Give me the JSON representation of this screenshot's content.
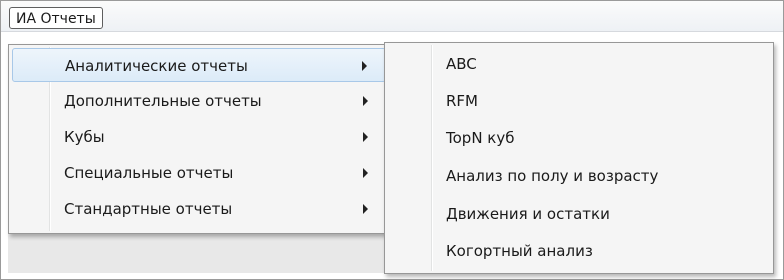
{
  "menubar": {
    "title": "ИА Отчеты"
  },
  "main_menu": {
    "items": [
      {
        "label": "Аналитические отчеты",
        "has_submenu": true,
        "highlighted": true
      },
      {
        "label": "Дополнительные отчеты",
        "has_submenu": true,
        "highlighted": false
      },
      {
        "label": "Кубы",
        "has_submenu": true,
        "highlighted": false
      },
      {
        "label": "Специальные отчеты",
        "has_submenu": true,
        "highlighted": false
      },
      {
        "label": "Стандартные отчеты",
        "has_submenu": true,
        "highlighted": false
      }
    ]
  },
  "sub_menu": {
    "items": [
      {
        "label": "ABC"
      },
      {
        "label": "RFM"
      },
      {
        "label": "TopN куб"
      },
      {
        "label": "Анализ по полу и возрасту"
      },
      {
        "label": "Движения и остатки"
      },
      {
        "label": "Когортный анализ"
      }
    ]
  },
  "colors": {
    "highlight_fill": "#dcebf8",
    "highlight_border": "#a8c8e8",
    "menu_background": "#f5f5f5"
  }
}
